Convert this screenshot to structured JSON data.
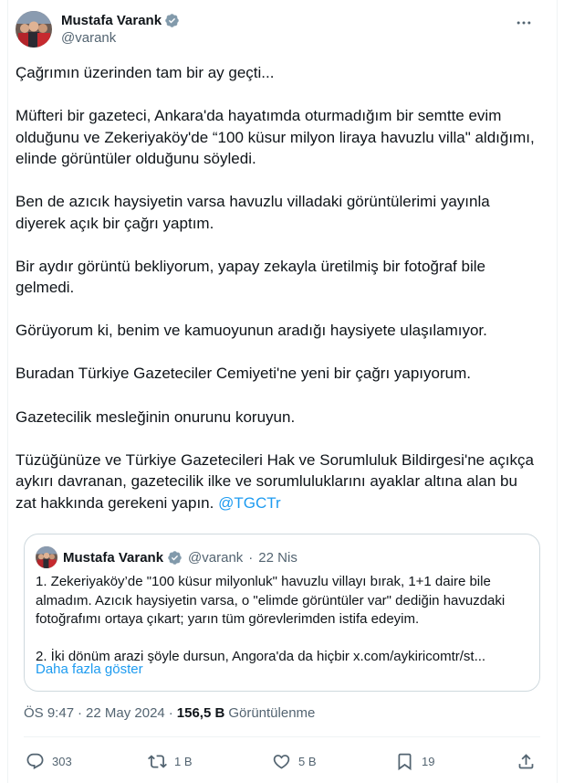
{
  "author": {
    "name": "Mustafa Varank",
    "handle": "@varank"
  },
  "tweet": {
    "paragraphs": [
      "Çağrımın üzerinden tam bir ay geçti...",
      "Müfteri bir gazeteci, Ankara'da hayatımda oturmadığım bir semtte evim olduğunu ve Zekeriyaköy'de “100 küsur milyon liraya havuzlu villa\" aldığımı, elinde görüntüler olduğunu söyledi.",
      "Ben de azıcık haysiyetin varsa havuzlu villadaki görüntülerimi yayınla diyerek açık bir çağrı yaptım.",
      "Bir aydır görüntü bekliyorum, yapay zekayla üretilmiş bir fotoğraf bile gelmedi.",
      "Görüyorum ki, benim ve kamuoyunun aradığı haysiyete ulaşılamıyor.",
      "Buradan Türkiye Gazeteciler Cemiyeti'ne yeni bir çağrı yapıyorum.",
      "Gazetecilik mesleğinin onurunu koruyun."
    ],
    "last_paragraph": "Tüzüğünüze ve Türkiye Gazetecileri Hak ve Sorumluluk Bildirgesi'ne açıkça aykırı davranan, gazetecilik ilke ve sorumluluklarını ayaklar altına alan bu zat hakkında gerekeni yapın.",
    "mention": "@TGCTr"
  },
  "quote": {
    "name": "Mustafa Varank",
    "handle": "@varank",
    "dot": "·",
    "date": "22 Nis",
    "text1": "1. Zekeriyaköy’de \"100 küsur milyonluk\" havuzlu villayı bırak, 1+1 daire bile almadım. Azıcık haysiyetin varsa, o \"elimde görüntüler var\" dediğin havuzdaki fotoğrafımı ortaya çıkart; yarın tüm görevlerimden istifa edeyim.",
    "text2": "2. İki dönüm arazi şöyle dursun, Angora'da da hiçbir x.com/aykiricomtr/st...",
    "show_more": "Daha fazla göster"
  },
  "meta": {
    "time": "ÖS 9:47",
    "dot": "·",
    "date": "22 May 2024",
    "views_count": "156,5 B",
    "views_label": "Görüntülenme"
  },
  "actions": {
    "replies": "303",
    "reposts": "1 B",
    "likes": "5 B",
    "bookmarks": "19"
  },
  "colors": {
    "accent": "#1d9bf0",
    "verified": "#829aab",
    "secondary_text": "#536471"
  }
}
